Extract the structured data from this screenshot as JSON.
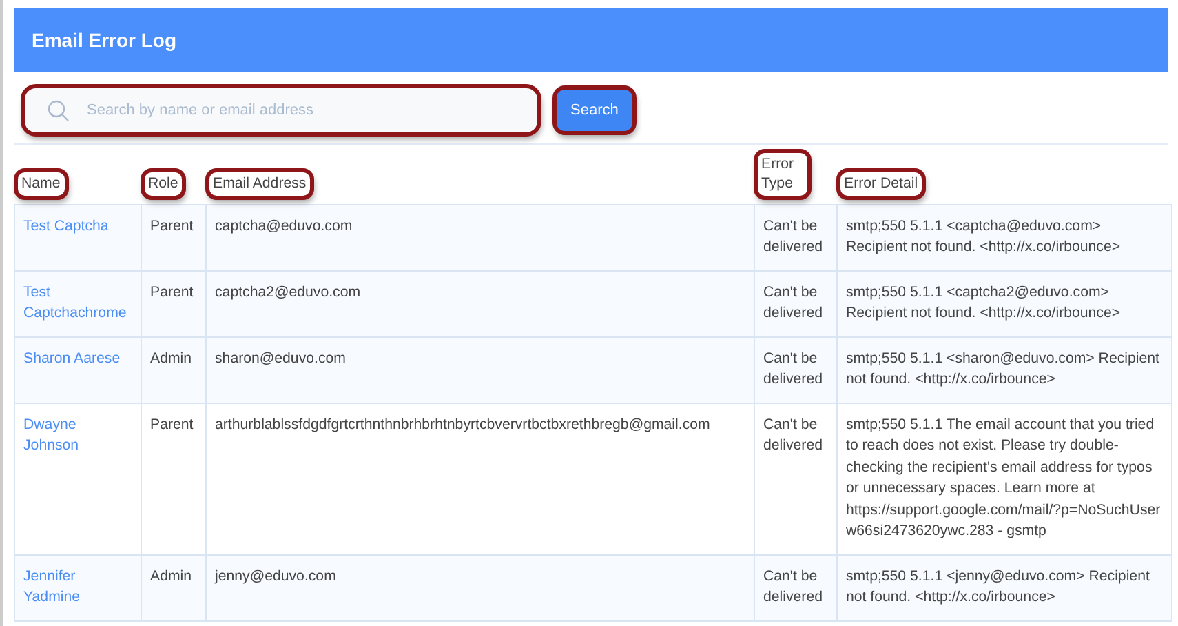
{
  "header": {
    "title": "Email Error Log"
  },
  "search": {
    "placeholder": "Search by name or email address",
    "highlighted": true
  },
  "search_button": {
    "label": "Search",
    "highlighted": true
  },
  "table": {
    "columns": [
      {
        "label": "Name",
        "highlighted": true
      },
      {
        "label": "Role",
        "highlighted": true
      },
      {
        "label": "Email Address",
        "highlighted": true
      },
      {
        "label": "Error Type",
        "highlighted": true
      },
      {
        "label": "Error Detail",
        "highlighted": true
      }
    ],
    "rows": [
      {
        "name": "Test Captcha",
        "role": "Parent",
        "email": "captcha@eduvo.com",
        "error_type": "Can't be delivered",
        "error_detail": "smtp;550 5.1.1 <captcha@eduvo.com> Recipient not found. <http://x.co/irbounce>"
      },
      {
        "name": "Test Captchachrome",
        "role": "Parent",
        "email": "captcha2@eduvo.com",
        "error_type": "Can't be delivered",
        "error_detail": "smtp;550 5.1.1 <captcha2@eduvo.com> Recipient not found. <http://x.co/irbounce>"
      },
      {
        "name": "Sharon Aarese",
        "role": "Admin",
        "email": "sharon@eduvo.com",
        "error_type": "Can't be delivered",
        "error_detail": "smtp;550 5.1.1 <sharon@eduvo.com> Recipient not found. <http://x.co/irbounce>"
      },
      {
        "name": "Dwayne Johnson",
        "role": "Parent",
        "email": "arthurblablssfdgdfgrtcrthnthnbrhbrhtnbyrtcbvervrtbctbxrethbregb@gmail.com",
        "error_type": "Can't be delivered",
        "error_detail": "smtp;550 5.1.1 The email account that you tried to reach does not exist. Please try double-checking the recipient's email address for typos or unnecessary spaces. Learn more at https://support.google.com/mail/?p=NoSuchUser w66si2473620ywc.283 - gsmtp"
      },
      {
        "name": "Jennifer Yadmine",
        "role": "Admin",
        "email": "jenny@eduvo.com",
        "error_type": "Can't be delivered",
        "error_detail": "smtp;550 5.1.1 <jenny@eduvo.com> Recipient not found. <http://x.co/irbounce>"
      }
    ]
  }
}
